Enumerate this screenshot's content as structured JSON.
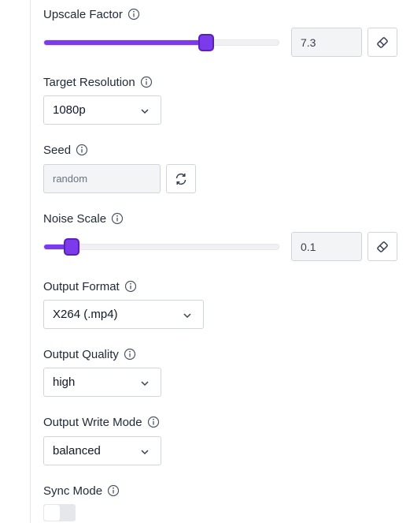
{
  "upscale_factor": {
    "label": "Upscale Factor",
    "value": "7.3",
    "slider_fraction": 0.69,
    "reset_icon": "eraser-icon"
  },
  "target_resolution": {
    "label": "Target Resolution",
    "selected": "1080p"
  },
  "seed": {
    "label": "Seed",
    "placeholder": "random",
    "refresh_icon": "refresh-icon"
  },
  "noise_scale": {
    "label": "Noise Scale",
    "value": "0.1",
    "slider_fraction": 0.12,
    "reset_icon": "eraser-icon"
  },
  "output_format": {
    "label": "Output Format",
    "selected": "X264 (.mp4)"
  },
  "output_quality": {
    "label": "Output Quality",
    "selected": "high"
  },
  "output_write_mode": {
    "label": "Output Write Mode",
    "selected": "balanced"
  },
  "sync_mode": {
    "label": "Sync Mode",
    "enabled": false
  },
  "colors": {
    "accent": "#7c3aed",
    "border": "#d1d5db"
  }
}
